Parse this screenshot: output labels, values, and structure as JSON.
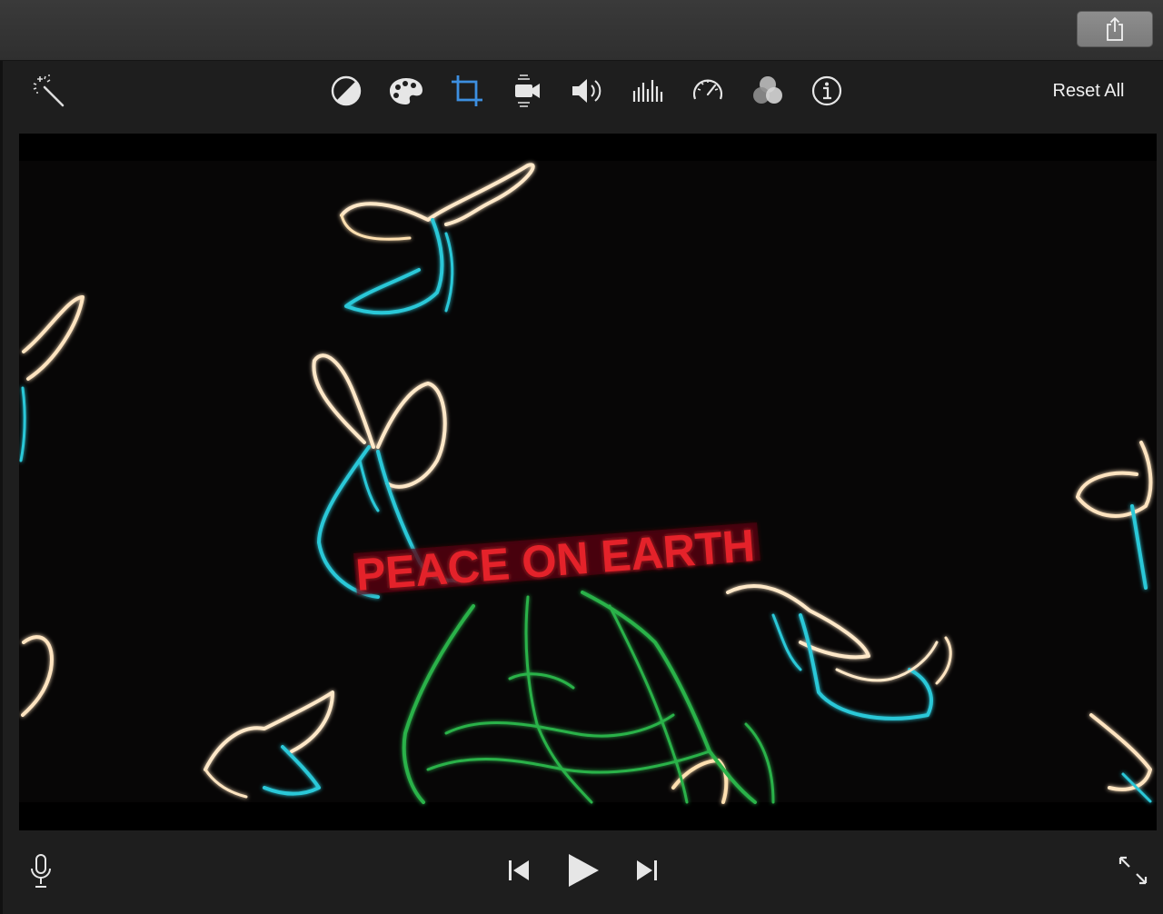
{
  "titlebar": {
    "share_icon": "share-icon"
  },
  "toolbar": {
    "tools": [
      {
        "name": "magic-wand-icon",
        "label": "Enhance"
      },
      {
        "name": "color-balance-icon",
        "label": "Color balance"
      },
      {
        "name": "color-correction-icon",
        "label": "Color correction"
      },
      {
        "name": "crop-icon",
        "label": "Cropping",
        "active": true
      },
      {
        "name": "stabilization-icon",
        "label": "Stabilization"
      },
      {
        "name": "volume-icon",
        "label": "Volume"
      },
      {
        "name": "noise-eq-icon",
        "label": "Noise reduction and equalizer"
      },
      {
        "name": "speed-icon",
        "label": "Speed"
      },
      {
        "name": "clip-filter-icon",
        "label": "Clip filter"
      },
      {
        "name": "info-icon",
        "label": "Clip information"
      }
    ],
    "reset_all_label": "Reset All",
    "accent_color": "#3d8fe0"
  },
  "viewer": {
    "banner_text": "PEACE ON EARTH"
  },
  "playback": {
    "voiceover_icon": "microphone-icon",
    "prev_icon": "skip-back-icon",
    "play_icon": "play-icon",
    "next_icon": "skip-forward-icon",
    "fullscreen_icon": "fullscreen-icon"
  }
}
